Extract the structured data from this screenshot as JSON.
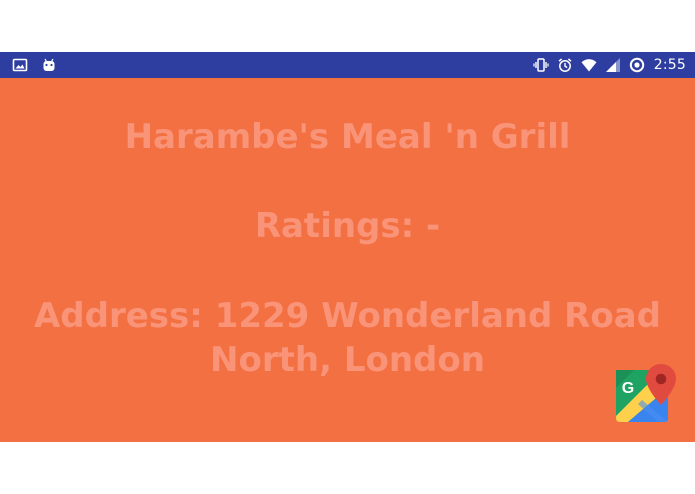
{
  "status_bar": {
    "time": "2:55",
    "left_icons": [
      "image-icon",
      "android-icon"
    ],
    "right_icons": [
      "vibrate-icon",
      "alarm-icon",
      "wifi-icon",
      "signal-icon",
      "location-icon"
    ]
  },
  "restaurant": {
    "name": "Harambe's Meal 'n Grill",
    "ratings": "Ratings: -",
    "address_line_1": "Address: 1229 Wonderland Road",
    "address_line_2": "North, London"
  },
  "actions": {
    "maps_icon": "google-maps-icon",
    "maps_letter": "G"
  },
  "colors": {
    "status_bar": "#2e3ea0",
    "background": "#f37043",
    "text": "#f99479"
  }
}
